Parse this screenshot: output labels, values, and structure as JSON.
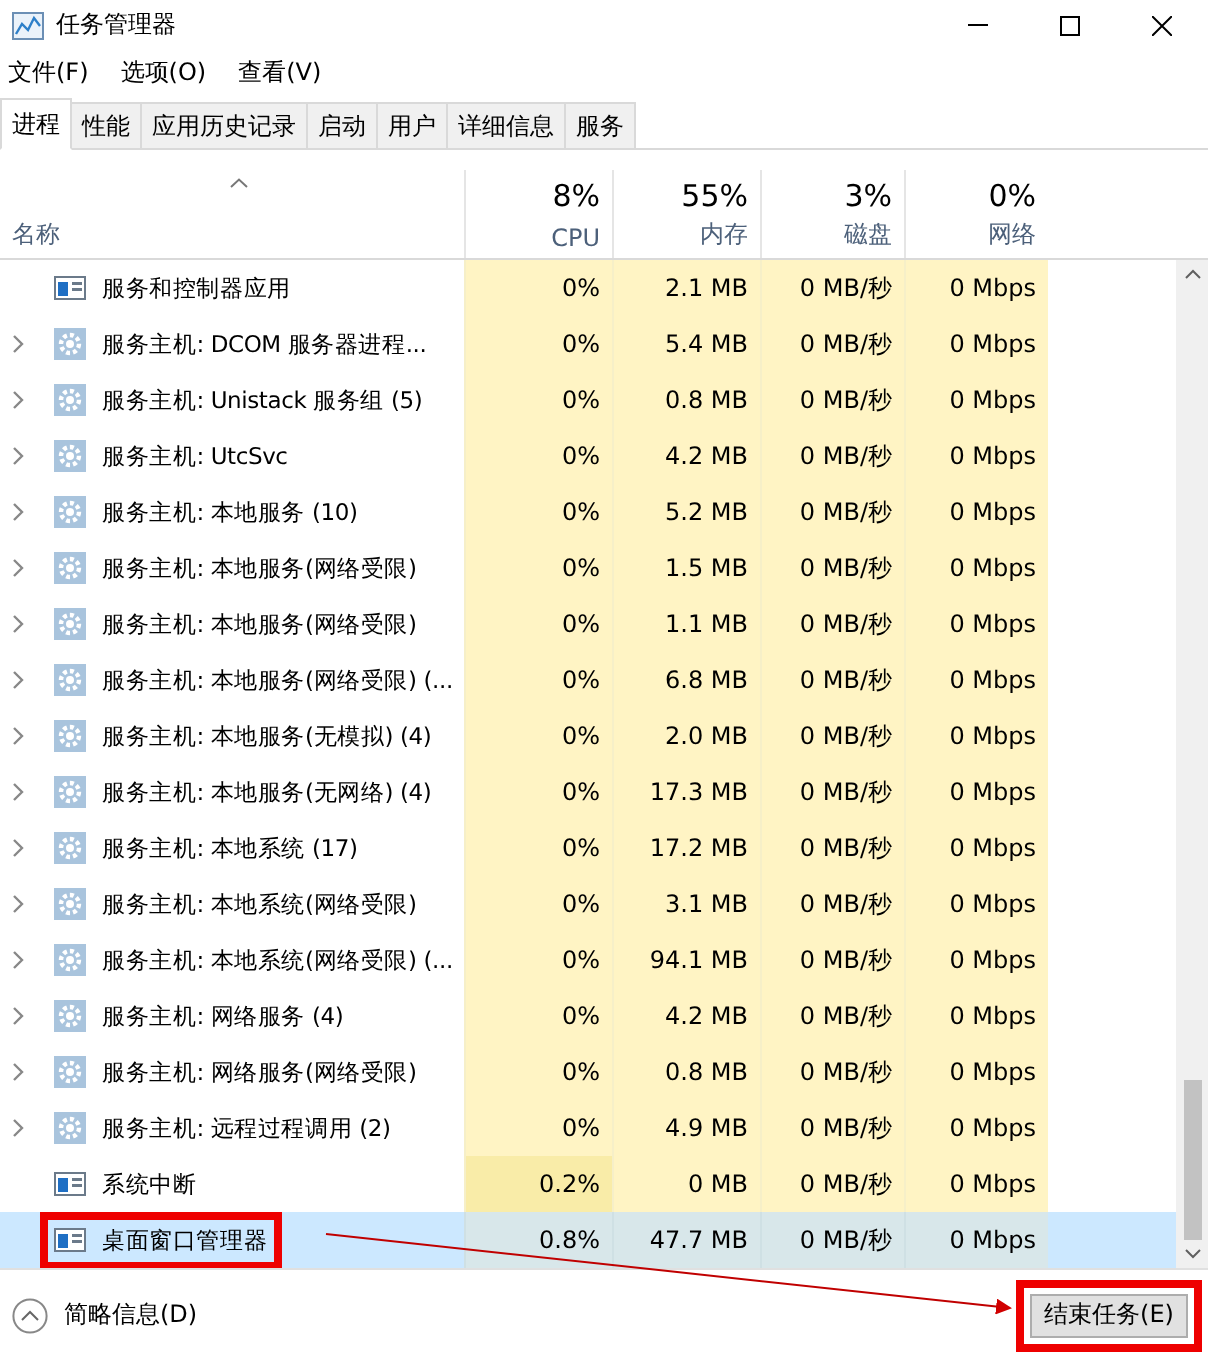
{
  "window": {
    "title": "任务管理器"
  },
  "menu": [
    "文件(F)",
    "选项(O)",
    "查看(V)"
  ],
  "tabs": [
    {
      "label": "进程",
      "selected": true
    },
    {
      "label": "性能",
      "selected": false
    },
    {
      "label": "应用历史记录",
      "selected": false
    },
    {
      "label": "启动",
      "selected": false
    },
    {
      "label": "用户",
      "selected": false
    },
    {
      "label": "详细信息",
      "selected": false
    },
    {
      "label": "服务",
      "selected": false
    }
  ],
  "table": {
    "name_column": "名称",
    "columns": [
      {
        "percent": "8%",
        "label": "CPU"
      },
      {
        "percent": "55%",
        "label": "内存"
      },
      {
        "percent": "3%",
        "label": "磁盘"
      },
      {
        "percent": "0%",
        "label": "网络"
      }
    ],
    "rows": [
      {
        "kind": "app",
        "expandable": false,
        "name": "服务和控制器应用",
        "values": [
          "0%",
          "2.1 MB",
          "0 MB/秒",
          "0 Mbps"
        ],
        "hot": false,
        "selected": false,
        "callout": false
      },
      {
        "kind": "service",
        "expandable": true,
        "name": "服务主机: DCOM 服务器进程...",
        "values": [
          "0%",
          "5.4 MB",
          "0 MB/秒",
          "0 Mbps"
        ],
        "hot": false,
        "selected": false,
        "callout": false
      },
      {
        "kind": "service",
        "expandable": true,
        "name": "服务主机: Unistack 服务组 (5)",
        "values": [
          "0%",
          "0.8 MB",
          "0 MB/秒",
          "0 Mbps"
        ],
        "hot": false,
        "selected": false,
        "callout": false
      },
      {
        "kind": "service",
        "expandable": true,
        "name": "服务主机: UtcSvc",
        "values": [
          "0%",
          "4.2 MB",
          "0 MB/秒",
          "0 Mbps"
        ],
        "hot": false,
        "selected": false,
        "callout": false
      },
      {
        "kind": "service",
        "expandable": true,
        "name": "服务主机: 本地服务 (10)",
        "values": [
          "0%",
          "5.2 MB",
          "0 MB/秒",
          "0 Mbps"
        ],
        "hot": false,
        "selected": false,
        "callout": false
      },
      {
        "kind": "service",
        "expandable": true,
        "name": "服务主机: 本地服务(网络受限)",
        "values": [
          "0%",
          "1.5 MB",
          "0 MB/秒",
          "0 Mbps"
        ],
        "hot": false,
        "selected": false,
        "callout": false
      },
      {
        "kind": "service",
        "expandable": true,
        "name": "服务主机: 本地服务(网络受限)",
        "values": [
          "0%",
          "1.1 MB",
          "0 MB/秒",
          "0 Mbps"
        ],
        "hot": false,
        "selected": false,
        "callout": false
      },
      {
        "kind": "service",
        "expandable": true,
        "name": "服务主机: 本地服务(网络受限) (...",
        "values": [
          "0%",
          "6.8 MB",
          "0 MB/秒",
          "0 Mbps"
        ],
        "hot": false,
        "selected": false,
        "callout": false
      },
      {
        "kind": "service",
        "expandable": true,
        "name": "服务主机: 本地服务(无模拟) (4)",
        "values": [
          "0%",
          "2.0 MB",
          "0 MB/秒",
          "0 Mbps"
        ],
        "hot": false,
        "selected": false,
        "callout": false
      },
      {
        "kind": "service",
        "expandable": true,
        "name": "服务主机: 本地服务(无网络) (4)",
        "values": [
          "0%",
          "17.3 MB",
          "0 MB/秒",
          "0 Mbps"
        ],
        "hot": false,
        "selected": false,
        "callout": false
      },
      {
        "kind": "service",
        "expandable": true,
        "name": "服务主机: 本地系统 (17)",
        "values": [
          "0%",
          "17.2 MB",
          "0 MB/秒",
          "0 Mbps"
        ],
        "hot": false,
        "selected": false,
        "callout": false
      },
      {
        "kind": "service",
        "expandable": true,
        "name": "服务主机: 本地系统(网络受限)",
        "values": [
          "0%",
          "3.1 MB",
          "0 MB/秒",
          "0 Mbps"
        ],
        "hot": false,
        "selected": false,
        "callout": false
      },
      {
        "kind": "service",
        "expandable": true,
        "name": "服务主机: 本地系统(网络受限) (...",
        "values": [
          "0%",
          "94.1 MB",
          "0 MB/秒",
          "0 Mbps"
        ],
        "hot": false,
        "selected": false,
        "callout": false
      },
      {
        "kind": "service",
        "expandable": true,
        "name": "服务主机: 网络服务 (4)",
        "values": [
          "0%",
          "4.2 MB",
          "0 MB/秒",
          "0 Mbps"
        ],
        "hot": false,
        "selected": false,
        "callout": false
      },
      {
        "kind": "service",
        "expandable": true,
        "name": "服务主机: 网络服务(网络受限)",
        "values": [
          "0%",
          "0.8 MB",
          "0 MB/秒",
          "0 Mbps"
        ],
        "hot": false,
        "selected": false,
        "callout": false
      },
      {
        "kind": "service",
        "expandable": true,
        "name": "服务主机: 远程过程调用 (2)",
        "values": [
          "0%",
          "4.9 MB",
          "0 MB/秒",
          "0 Mbps"
        ],
        "hot": false,
        "selected": false,
        "callout": false
      },
      {
        "kind": "app",
        "expandable": false,
        "name": "系统中断",
        "values": [
          "0.2%",
          "0 MB",
          "0 MB/秒",
          "0 Mbps"
        ],
        "hot": true,
        "selected": false,
        "callout": false
      },
      {
        "kind": "app",
        "expandable": false,
        "name": "桌面窗口管理器",
        "values": [
          "0.8%",
          "47.7 MB",
          "0 MB/秒",
          "0 Mbps"
        ],
        "hot": false,
        "selected": true,
        "callout": true
      }
    ]
  },
  "footer": {
    "details": "简略信息(D)",
    "end_task": {
      "label": "结束任务(E)",
      "callout": true
    }
  }
}
